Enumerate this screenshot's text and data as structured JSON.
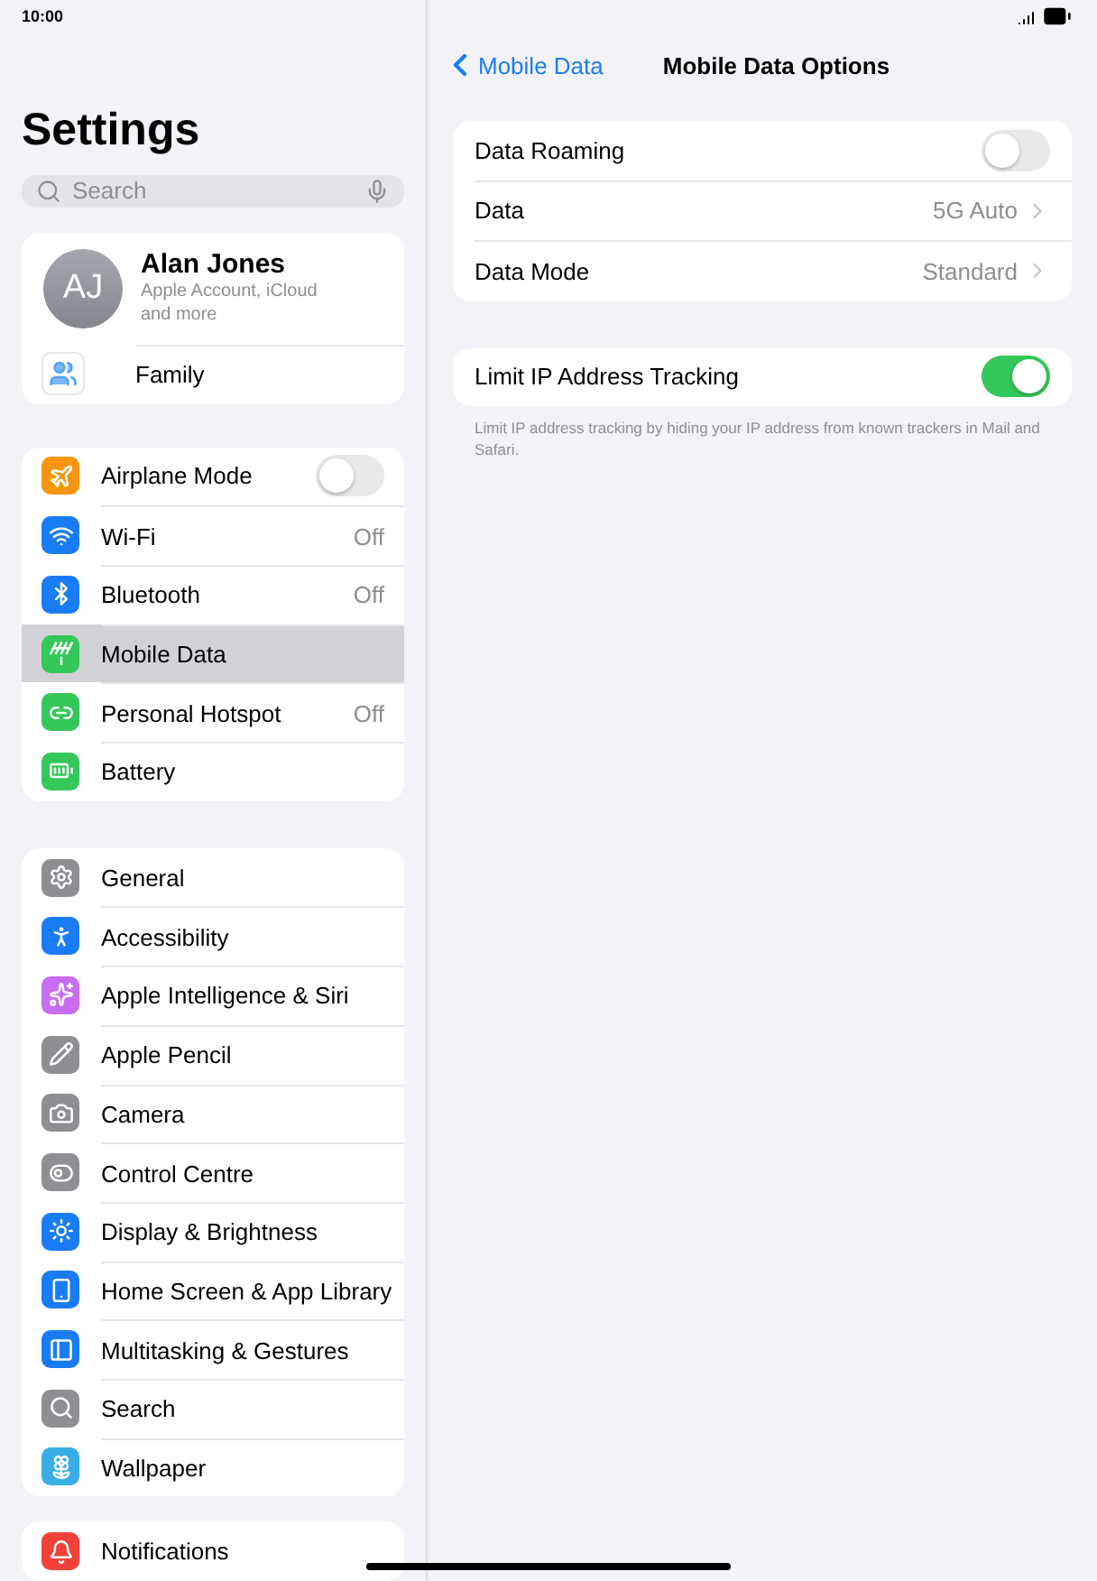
{
  "status_bar": {
    "time": "10:00"
  },
  "sidebar": {
    "title": "Settings",
    "search": {
      "placeholder": "Search"
    },
    "account": {
      "initials": "AJ",
      "name": "Alan Jones",
      "subtitle": "Apple Account, iCloud and more",
      "family": "Family"
    },
    "groups": [
      [
        {
          "label": "Airplane Mode",
          "kind": "toggle",
          "on": false,
          "selected": false,
          "color": "#f7960c"
        },
        {
          "label": "Wi-Fi",
          "kind": "value",
          "value": "Off",
          "selected": false,
          "color": "#1a7cf5"
        },
        {
          "label": "Bluetooth",
          "kind": "value",
          "value": "Off",
          "selected": false,
          "color": "#1a7cf5"
        },
        {
          "label": "Mobile Data",
          "kind": "plain",
          "selected": true,
          "color": "#34c759"
        },
        {
          "label": "Personal Hotspot",
          "kind": "value",
          "value": "Off",
          "selected": false,
          "color": "#34c759"
        },
        {
          "label": "Battery",
          "kind": "plain",
          "selected": false,
          "color": "#34c759"
        }
      ],
      [
        {
          "label": "General",
          "kind": "plain",
          "selected": false,
          "color": "#8e8e93"
        },
        {
          "label": "Accessibility",
          "kind": "plain",
          "selected": false,
          "color": "#1a7cf5"
        },
        {
          "label": "Apple Intelligence & Siri",
          "kind": "plain",
          "selected": false,
          "color": "#c86cf0"
        },
        {
          "label": "Apple Pencil",
          "kind": "plain",
          "selected": false,
          "color": "#8e8e93"
        },
        {
          "label": "Camera",
          "kind": "plain",
          "selected": false,
          "color": "#8e8e93"
        },
        {
          "label": "Control Centre",
          "kind": "plain",
          "selected": false,
          "color": "#8e8e93"
        },
        {
          "label": "Display & Brightness",
          "kind": "plain",
          "selected": false,
          "color": "#1a7cf5"
        },
        {
          "label": "Home Screen & App Library",
          "kind": "plain",
          "selected": false,
          "color": "#1a7cf5"
        },
        {
          "label": "Multitasking & Gestures",
          "kind": "plain",
          "selected": false,
          "color": "#1a7cf5"
        },
        {
          "label": "Search",
          "kind": "plain",
          "selected": false,
          "color": "#8e8e93"
        },
        {
          "label": "Wallpaper",
          "kind": "plain",
          "selected": false,
          "color": "#37aee6"
        }
      ],
      [
        {
          "label": "Notifications",
          "kind": "plain",
          "selected": false,
          "color": "#f2413a"
        }
      ]
    ]
  },
  "detail": {
    "back": "Mobile Data",
    "title": "Mobile Data Options",
    "groups": [
      {
        "rows": [
          {
            "label": "Data Roaming",
            "kind": "toggle",
            "on": false
          },
          {
            "label": "Data",
            "kind": "link",
            "value": "5G Auto"
          },
          {
            "label": "Data Mode",
            "kind": "link",
            "value": "Standard"
          }
        ]
      },
      {
        "rows": [
          {
            "label": "Limit IP Address Tracking",
            "kind": "toggle",
            "on": true
          }
        ],
        "footer": "Limit IP address tracking by hiding your IP address from known trackers in Mail and Safari."
      }
    ]
  }
}
